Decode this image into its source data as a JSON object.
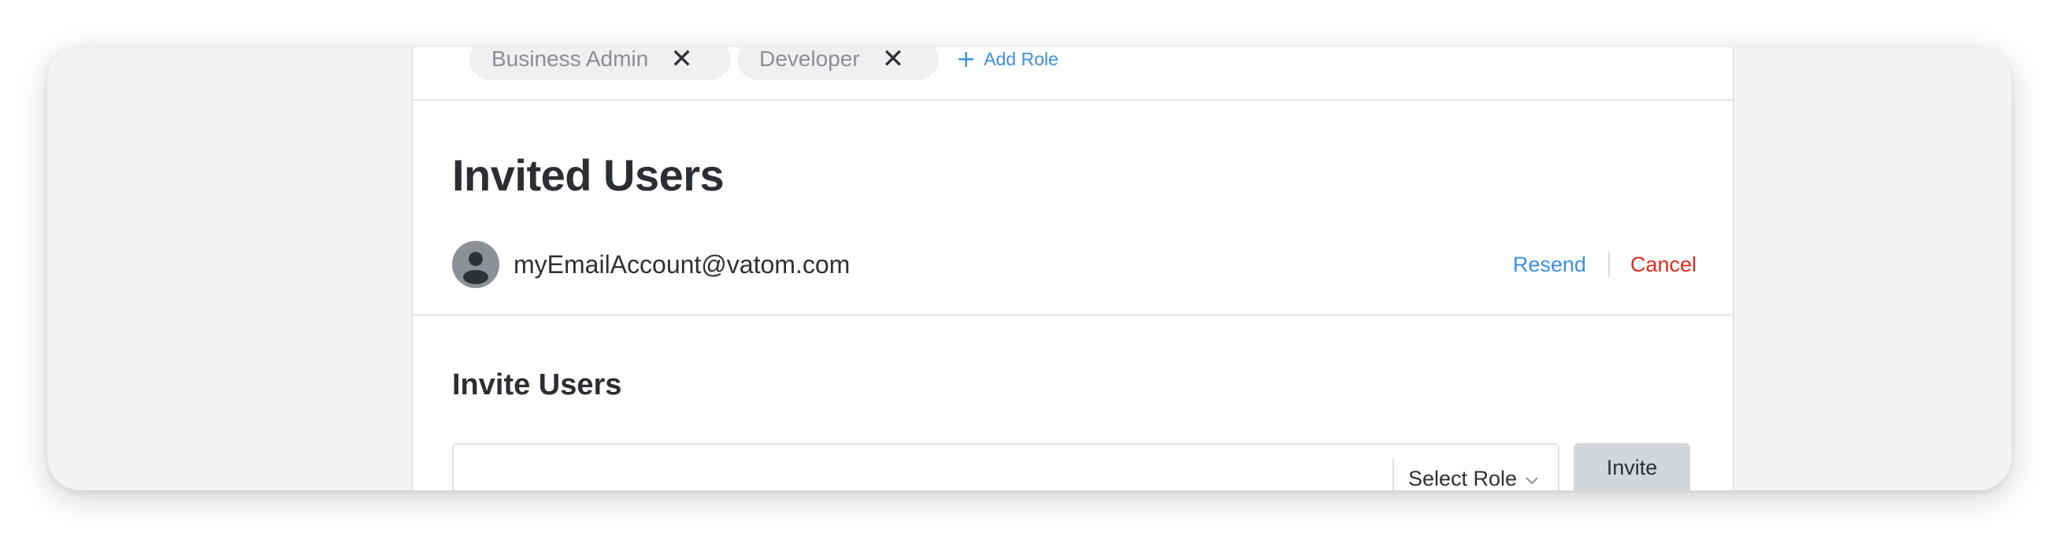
{
  "roles": {
    "chips": [
      {
        "label": "Business Admin",
        "remove_glyph": "✕"
      },
      {
        "label": "Developer",
        "remove_glyph": "✕"
      }
    ],
    "add_role_label": "Add Role",
    "add_role_glyph": "+"
  },
  "invited_users": {
    "title": "Invited Users",
    "users": [
      {
        "email": "myEmailAccount@vatom.com",
        "resend_label": "Resend",
        "cancel_label": "Cancel"
      }
    ]
  },
  "invite_users": {
    "title": "Invite Users",
    "input_value": "",
    "input_placeholder": "",
    "select_role_label": "Select Role",
    "invite_button_label": "Invite"
  },
  "icons": {
    "remove": "close-icon",
    "add": "plus-icon",
    "avatar": "user-avatar-icon",
    "select": "chevron-down-icon"
  },
  "colors": {
    "link_blue": "#3b8fe0",
    "cancel_red": "#e02b1f",
    "heading": "#2b2e33",
    "chip_bg": "#eff0f2",
    "button_bg": "#d3d6db"
  }
}
